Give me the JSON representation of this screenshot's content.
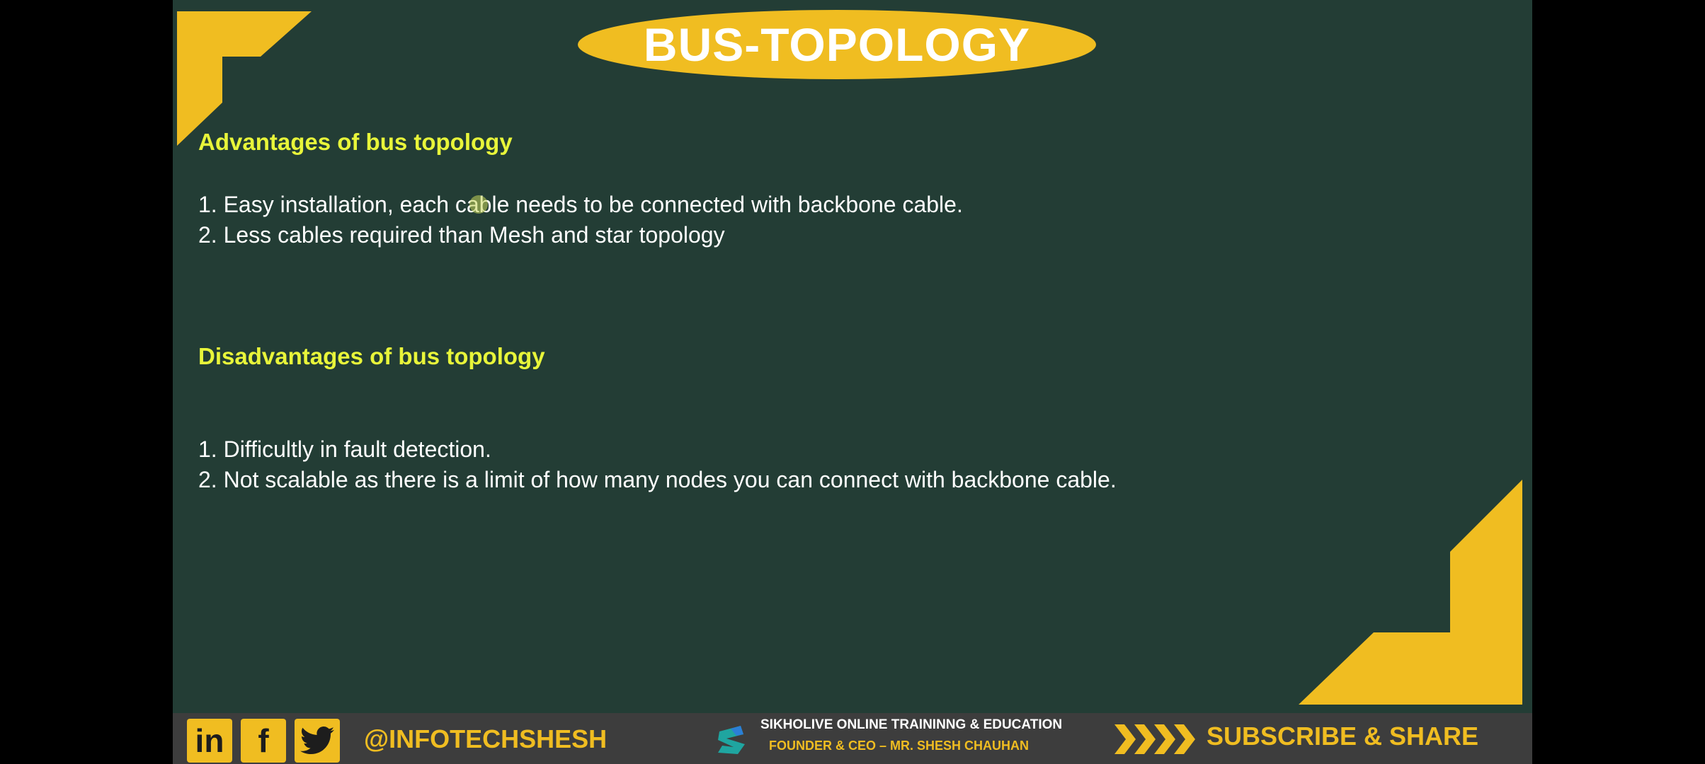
{
  "slide": {
    "title": "BUS-TOPOLOGY",
    "advantages": {
      "heading": "Advantages of bus topology",
      "items": [
        "1. Easy installation, each cable needs to be connected with backbone cable.",
        "2. Less cables required than Mesh and star topology"
      ]
    },
    "disadvantages": {
      "heading": "Disadvantages of bus topology",
      "items": [
        "1. Difficultly in fault detection.",
        "2. Not scalable as there is a limit of how many nodes you can connect with backbone cable."
      ]
    }
  },
  "footer": {
    "social_icons": [
      "linkedin-icon",
      "facebook-icon",
      "twitter-icon"
    ],
    "linkedin_label": "in",
    "facebook_label": "f",
    "handle": "@INFOTECHSHESH",
    "brand_line1": "SIKHOLIVE ONLINE TRAININNG & EDUCATION",
    "brand_line2": "FOUNDER & CEO – MR. SHESH CHAUHAN",
    "subscribe": "SUBSCRIBE & SHARE"
  },
  "colors": {
    "background": "#233d35",
    "accent": "#f0bd21",
    "heading": "#e8f53a",
    "text": "#ffffff",
    "footer": "#3d3d3d"
  }
}
